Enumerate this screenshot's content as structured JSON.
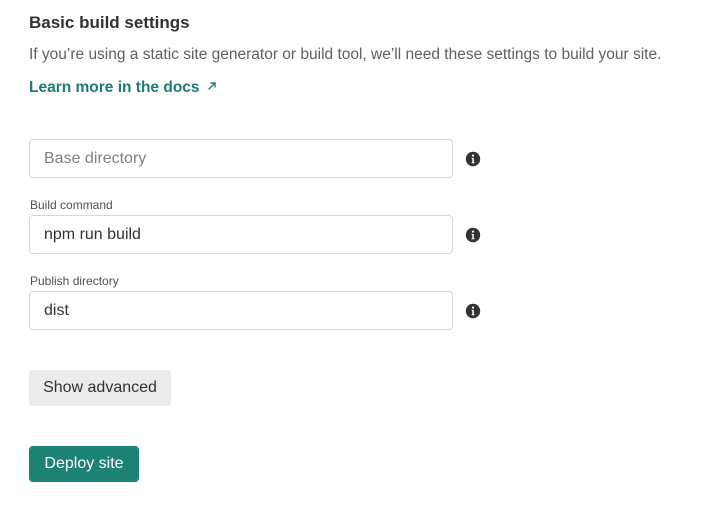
{
  "section": {
    "title": "Basic build settings",
    "description": "If you’re using a static site generator or build tool, we’ll need these settings to build your site.",
    "docs_link": "Learn more in the docs",
    "docs_link_icon": "external-link-icon"
  },
  "fields": {
    "base_directory": {
      "label": "",
      "value": "",
      "placeholder": "Base directory",
      "icon": "info-icon"
    },
    "build_command": {
      "label": "Build command",
      "value": "npm run build",
      "icon": "info-icon"
    },
    "publish_directory": {
      "label": "Publish directory",
      "value": "dist",
      "icon": "info-icon"
    }
  },
  "buttons": {
    "show_advanced": "Show advanced",
    "deploy": "Deploy site"
  },
  "colors": {
    "accent": "#1b8275",
    "link": "#1b7c73",
    "secondary_button_bg": "#e9ebed",
    "info_icon": "#2e3338"
  }
}
